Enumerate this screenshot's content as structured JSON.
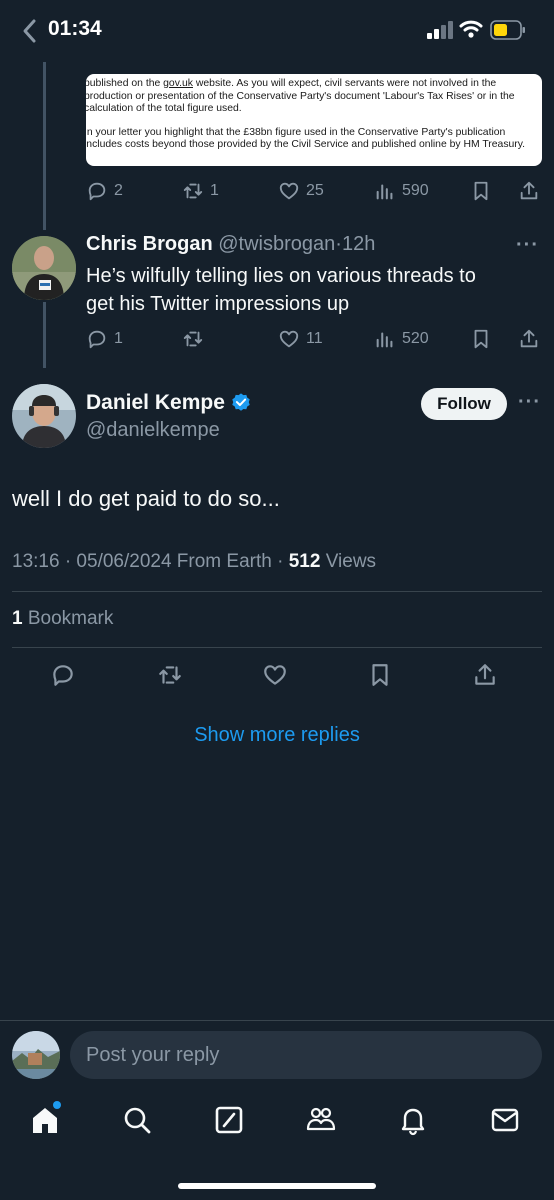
{
  "status_bar": {
    "time": "01:34"
  },
  "quoted_letter": {
    "lines_p1": [
      "published on the ",
      "gov.uk",
      " website. As you will expect, civil servants were not involved in the",
      "production or presentation of the Conservative Party's document 'Labour's Tax Rises' or in the",
      "calculation of the total figure used."
    ],
    "lines_p2": [
      "In your letter you highlight that the £38bn figure used in the Conservative Party's publication",
      "includes costs beyond those provided by the Civil Service and published online by HM Treasury."
    ]
  },
  "first_tweet_actions": {
    "replies": "2",
    "retweets": "1",
    "likes": "25",
    "views": "590"
  },
  "reply_tweet": {
    "display_name": "Chris Brogan",
    "handle": "@twisbrogan",
    "separator": "·",
    "time": "12h",
    "text_line1": "He’s wilfully telling lies on various threads to",
    "text_line2": "get his Twitter impressions up",
    "replies": "1",
    "likes": "11",
    "views": "520",
    "more": "···"
  },
  "main_tweet": {
    "display_name": "Daniel Kempe",
    "handle": "@danielkempe",
    "follow_label": "Follow",
    "more": "···",
    "text": "well I do get paid to do so...",
    "meta_time": "13:16 · 05/06/2024 From Earth · ",
    "views_count": "512",
    "views_label": " Views",
    "bookmark_count": "1",
    "bookmark_label": " Bookmark"
  },
  "show_more_replies": "Show more replies",
  "reply_bar": {
    "placeholder": "Post your reply"
  },
  "colors": {
    "background": "#15202b",
    "accent": "#1d9bf0",
    "muted": "#8b98a5",
    "verified": "#1d9bf0"
  },
  "nav": [
    "home-icon",
    "search-icon",
    "grok-icon",
    "communities-icon",
    "notifications-icon",
    "messages-icon"
  ]
}
